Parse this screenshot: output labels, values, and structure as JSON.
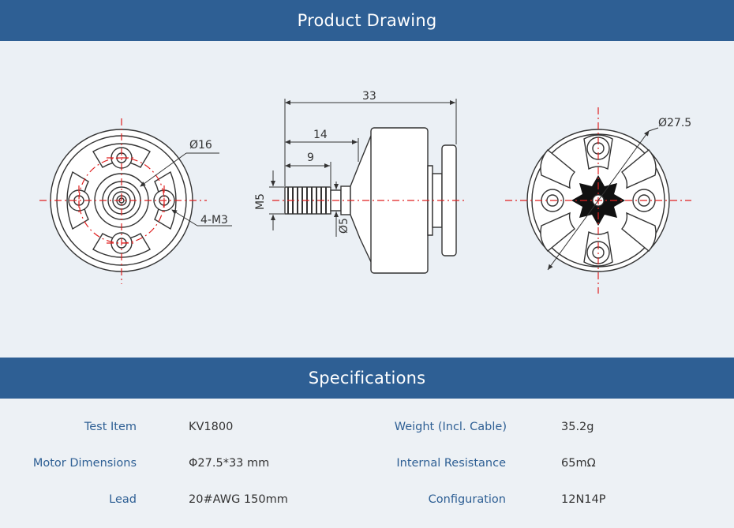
{
  "header": {
    "title": "Product Drawing"
  },
  "specs_header": {
    "title": "Specifications"
  },
  "drawing": {
    "dim_overall_length": "33",
    "dim_14": "14",
    "dim_9": "9",
    "dim_shaft_thread": "M5",
    "dim_shaft_dia": "Ø5",
    "dim_mount_circle": "Ø16",
    "dim_mount_holes": "4-M3",
    "dim_bell_dia": "Ø27.5"
  },
  "specs": {
    "rows": [
      {
        "label_left": "Test Item",
        "value_left": "KV1800",
        "label_right": "Weight (Incl. Cable)",
        "value_right": "35.2g"
      },
      {
        "label_left": "Motor Dimensions",
        "value_left": "Φ27.5*33 mm",
        "label_right": "Internal Resistance",
        "value_right": "65mΩ"
      },
      {
        "label_left": "Lead",
        "value_left": "20#AWG 150mm",
        "label_right": "Configuration",
        "value_right": "12N14P"
      }
    ]
  },
  "colors": {
    "banner": "#2e5f94",
    "label": "#2e5f94",
    "centerline": "#e02020",
    "outline": "#333333"
  }
}
